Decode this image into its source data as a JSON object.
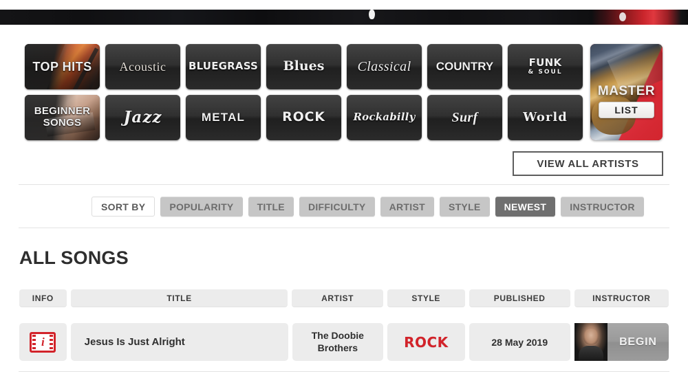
{
  "banner": {
    "alt": "dark-cropped-hero-strip"
  },
  "categories": {
    "row1": [
      {
        "label": "TOP HITS",
        "style": "t-tophits",
        "photo": true
      },
      {
        "label": "Acoustic",
        "style": "t-acoustic",
        "photo": false
      },
      {
        "label": "BLUEGRASS",
        "style": "t-bluegrass",
        "photo": false
      },
      {
        "label": "Blues",
        "style": "t-blues",
        "photo": false
      },
      {
        "label": "Classical",
        "style": "t-classical",
        "photo": false
      },
      {
        "label": "COUNTRY",
        "style": "t-country",
        "photo": false
      },
      {
        "label": "FUNK",
        "sub": "& SOUL",
        "style": "t-funk",
        "photo": false
      }
    ],
    "row2": [
      {
        "label": "BEGINNER SONGS",
        "style": "t-beginner",
        "photo": true
      },
      {
        "label": "Jazz",
        "style": "t-jazz",
        "photo": false
      },
      {
        "label": "METAL",
        "style": "t-metal",
        "photo": false
      },
      {
        "label": "ROCK",
        "style": "t-rock",
        "photo": false
      },
      {
        "label": "Rockabilly",
        "style": "t-rockabilly",
        "photo": false
      },
      {
        "label": "Surf",
        "style": "t-surf",
        "photo": false
      },
      {
        "label": "World",
        "style": "t-world",
        "photo": false
      }
    ],
    "master": {
      "title": "MASTER",
      "button": "LIST"
    }
  },
  "view_all_artists": "VIEW ALL ARTISTS",
  "sort": {
    "lead_label": "SORT BY",
    "options": [
      {
        "label": "POPULARITY",
        "active": false
      },
      {
        "label": "TITLE",
        "active": false
      },
      {
        "label": "DIFFICULTY",
        "active": false
      },
      {
        "label": "ARTIST",
        "active": false
      },
      {
        "label": "STYLE",
        "active": false
      },
      {
        "label": "NEWEST",
        "active": true
      },
      {
        "label": "INSTRUCTOR",
        "active": false
      }
    ]
  },
  "section_title": "ALL SONGS",
  "table": {
    "headers": {
      "info": "INFO",
      "title": "TITLE",
      "artist": "ARTIST",
      "style": "STYLE",
      "published": "PUBLISHED",
      "instructor": "INSTRUCTOR"
    },
    "rows": [
      {
        "info_icon": "film-info-icon",
        "title": "Jesus Is Just Alright",
        "artist": "The Doobie Brothers",
        "style": "ROCK",
        "published": "28 May 2019",
        "instructor_thumb": "instructor-portrait",
        "begin_label": "BEGIN"
      }
    ]
  },
  "colors": {
    "accent_red": "#d2232a",
    "tile_dark": "#2e2e2e",
    "pill_inactive": "#c6c6c6",
    "pill_active": "#6f6f6f",
    "cell_bg": "#ececec",
    "master_red": "#cf2430"
  }
}
